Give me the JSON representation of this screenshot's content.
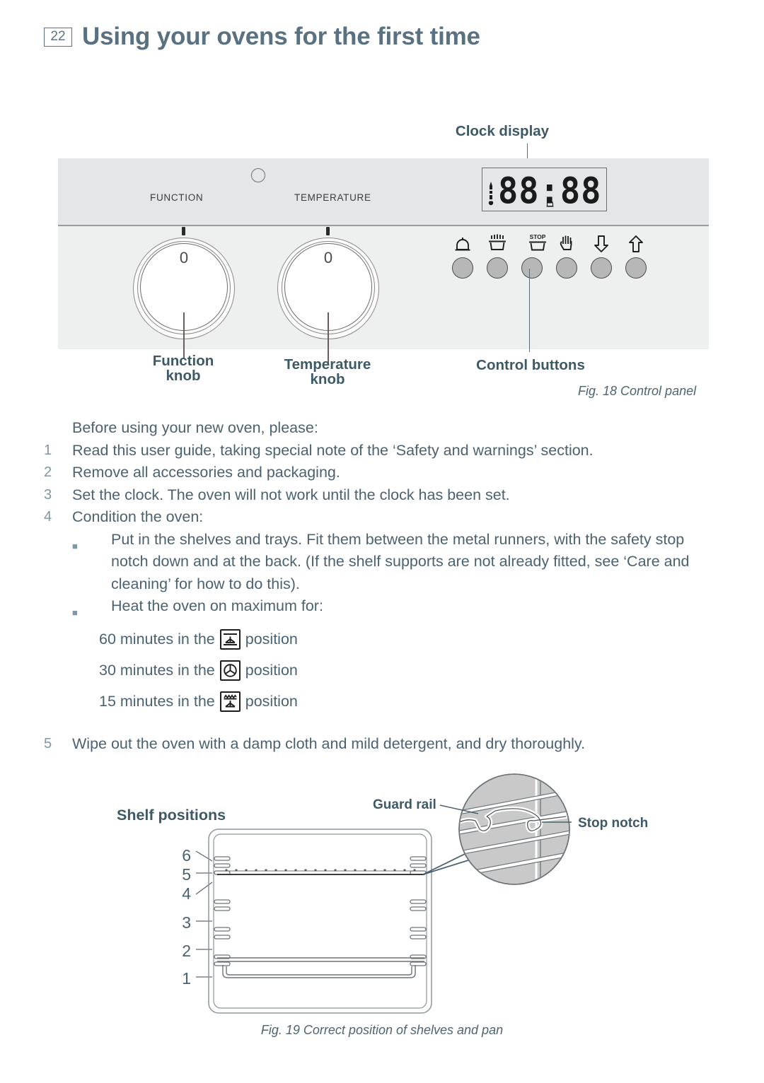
{
  "header": {
    "page_number": "22",
    "title": "Using your ovens for the first time"
  },
  "fig18": {
    "caption": "Fig. 18 Control panel",
    "panel_labels": {
      "function": "FUNCTION",
      "temperature": "TEMPERATURE"
    },
    "knob_value": "0",
    "clock_display": {
      "digits": "88:88",
      "thermometer_icon": "thermometer-icon",
      "bell_icon": "bell-icon"
    },
    "callouts": {
      "clock_display": "Clock display",
      "function_knob": "Function\nknob",
      "temperature_knob": "Temperature\nknob",
      "control_buttons": "Control buttons"
    },
    "buttons": [
      {
        "icon": "bell-icon",
        "label": ""
      },
      {
        "icon": "cooking-pot-steam-icon",
        "label": ""
      },
      {
        "icon": "stop-pot-icon",
        "label": "STOP"
      },
      {
        "icon": "hand-icon",
        "label": ""
      },
      {
        "icon": "arrow-down-icon",
        "label": ""
      },
      {
        "icon": "arrow-up-icon",
        "label": ""
      }
    ]
  },
  "instructions": {
    "intro": "Before using your new oven, please:",
    "steps": [
      {
        "n": "1",
        "text": "Read this user guide, taking special note of the ‘Safety and warnings’ section."
      },
      {
        "n": "2",
        "text": "Remove all accessories and packaging."
      },
      {
        "n": "3",
        "text": "Set the clock. The oven will not work until the clock has been set."
      },
      {
        "n": "4",
        "text": "Condition the oven:"
      }
    ],
    "bullets": [
      "Put in the shelves and trays. Fit them between the metal runners, with the safety stop notch down and at the back. (If the shelf supports are not already fitted, see ‘Care and cleaning’ for how to do this).",
      "Heat the oven on maximum for:"
    ],
    "heat_positions": [
      {
        "prefix": "60 minutes in the",
        "icon": "fan-forced-oven-icon",
        "suffix": "position"
      },
      {
        "prefix": "30 minutes in the",
        "icon": "fan-only-oven-icon",
        "suffix": "position"
      },
      {
        "prefix": "15 minutes in the",
        "icon": "fan-grill-oven-icon",
        "suffix": "position"
      }
    ],
    "step5": {
      "n": "5",
      "text": "Wipe out the oven with a damp cloth and mild detergent, and dry thoroughly."
    }
  },
  "fig19": {
    "title": "Shelf positions",
    "caption": "Fig. 19 Correct position of shelves and pan",
    "labels": {
      "guard_rail": "Guard rail",
      "stop_notch": "Stop notch"
    },
    "shelf_numbers": [
      "6",
      "5",
      "4",
      "3",
      "2",
      "1"
    ]
  },
  "colors": {
    "text": "#4b6270",
    "heading": "#5a7181",
    "callout": "#3e5966",
    "panel_upper": "#e4e6e7",
    "panel_lower": "#eeefef",
    "button_fill": "#b7b7b7",
    "detail_circle_fill": "#c9c9c9"
  }
}
